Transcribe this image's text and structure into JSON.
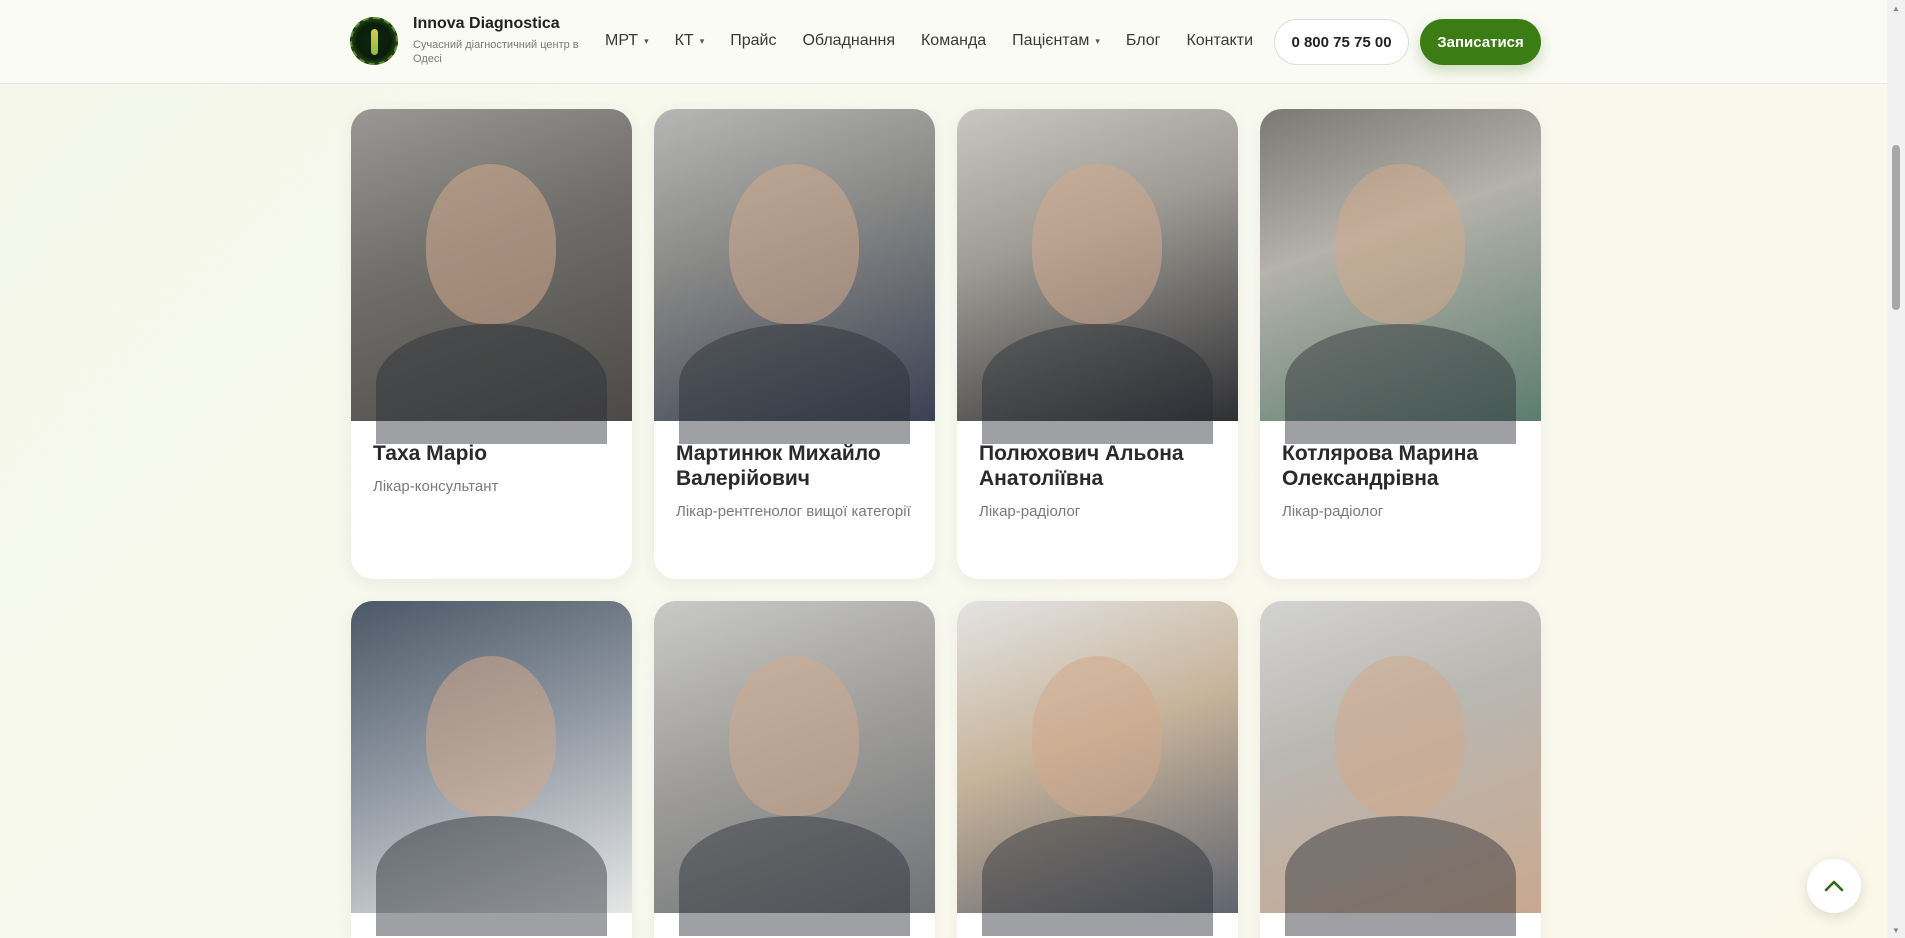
{
  "brand": {
    "name": "Innova Diagnostica",
    "subtitle": "Сучасний діагностичний центр в Одесі"
  },
  "nav": {
    "items": [
      {
        "label": "МРТ",
        "has_dropdown": true
      },
      {
        "label": "КТ",
        "has_dropdown": true
      },
      {
        "label": "Прайс",
        "has_dropdown": false
      },
      {
        "label": "Обладнання",
        "has_dropdown": false
      },
      {
        "label": "Команда",
        "has_dropdown": false
      },
      {
        "label": "Пацієнтам",
        "has_dropdown": true
      },
      {
        "label": "Блог",
        "has_dropdown": false
      },
      {
        "label": "Контакти",
        "has_dropdown": false
      }
    ],
    "caret": "▾"
  },
  "phone": "0 800 75 75 00",
  "cta": "Записатися",
  "doctors": [
    {
      "name": "Таха Маріо",
      "role": "Лікар-консультант"
    },
    {
      "name": "Мартинюк Михайло Валерійович",
      "role": "Лікар-рентгенолог вищої категорії"
    },
    {
      "name": "Полюхович Альона Анатоліївна",
      "role": "Лікар-радіолог"
    },
    {
      "name": "Котлярова Марина Олександрівна",
      "role": "Лікар-радіолог"
    }
  ],
  "colors": {
    "accent": "#3b7d14",
    "background": "#f4f7ea"
  },
  "icons": {
    "to_top": "chevron-up-icon",
    "scroll_up": "▲",
    "scroll_down": "▼"
  }
}
